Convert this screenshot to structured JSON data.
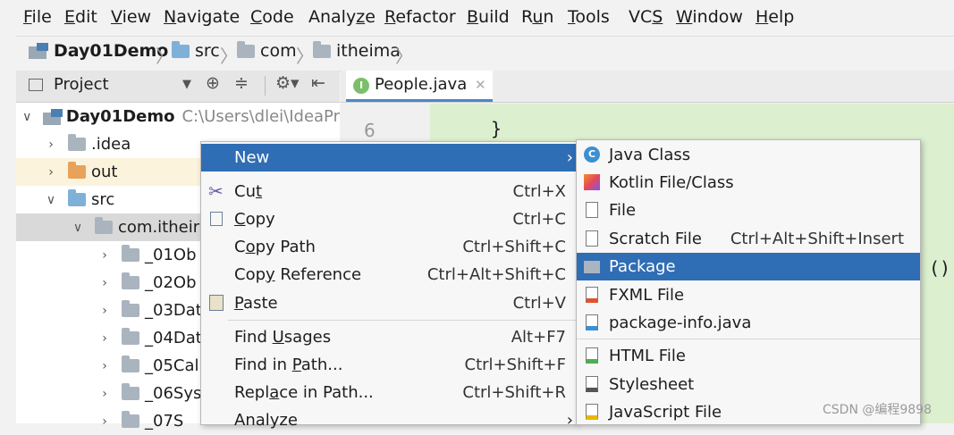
{
  "menubar": {
    "items": [
      {
        "pre": "",
        "mn": "F",
        "post": "ile"
      },
      {
        "pre": "",
        "mn": "E",
        "post": "dit"
      },
      {
        "pre": "",
        "mn": "V",
        "post": "iew"
      },
      {
        "pre": "",
        "mn": "N",
        "post": "avigate"
      },
      {
        "pre": "",
        "mn": "C",
        "post": "ode"
      },
      {
        "pre": "Analy",
        "mn": "z",
        "post": "e"
      },
      {
        "pre": "",
        "mn": "R",
        "post": "efactor"
      },
      {
        "pre": "",
        "mn": "B",
        "post": "uild"
      },
      {
        "pre": "R",
        "mn": "u",
        "post": "n"
      },
      {
        "pre": "",
        "mn": "T",
        "post": "ools"
      },
      {
        "pre": "VC",
        "mn": "S",
        "post": ""
      },
      {
        "pre": "",
        "mn": "W",
        "post": "indow"
      },
      {
        "pre": "",
        "mn": "H",
        "post": "elp"
      }
    ]
  },
  "breadcrumb": [
    "Day01Demo",
    "src",
    "com",
    "itheima"
  ],
  "project_toolbar": {
    "label": "Project",
    "icons": [
      "dropdown-icon",
      "target-icon",
      "collapse-icon",
      "gear-icon",
      "hide-icon"
    ]
  },
  "editor": {
    "tab_label": "People.java",
    "tab_badge": "I",
    "line_number": "6",
    "code": "}",
    "right_text": "()"
  },
  "tree": {
    "root": {
      "label": "Day01Demo",
      "path": "C:\\Users\\dlei\\IdeaPr"
    },
    "items": [
      ".idea",
      "out",
      "src",
      "com.itheir",
      "_01Ob",
      "_02Ob",
      "_03Dat",
      "_04Dat",
      "_05Cal",
      "_06Sys",
      "_07S"
    ]
  },
  "context_menu": {
    "new": "New",
    "cut": {
      "pre": "Cu",
      "mn": "t",
      "post": "",
      "shortcut": "Ctrl+X"
    },
    "copy": {
      "pre": "",
      "mn": "C",
      "post": "opy",
      "shortcut": "Ctrl+C"
    },
    "copy_path": {
      "pre": "C",
      "mn": "o",
      "post": "py Path",
      "shortcut": "Ctrl+Shift+C"
    },
    "copy_ref": {
      "pre": "Cop",
      "mn": "y",
      "post": " Reference",
      "shortcut": "Ctrl+Alt+Shift+C"
    },
    "paste": {
      "pre": "",
      "mn": "P",
      "post": "aste",
      "shortcut": "Ctrl+V"
    },
    "find_usages": {
      "pre": "Find ",
      "mn": "U",
      "post": "sages",
      "shortcut": "Alt+F7"
    },
    "find_in_path": {
      "pre": "Find in ",
      "mn": "P",
      "post": "ath...",
      "shortcut": "Ctrl+Shift+F"
    },
    "replace_in_path": {
      "pre": "Repl",
      "mn": "a",
      "post": "ce in Path...",
      "shortcut": "Ctrl+Shift+R"
    },
    "analyze": "Analyze"
  },
  "submenu": {
    "items": [
      {
        "label": "Java Class",
        "shortcut": ""
      },
      {
        "label": "Kotlin File/Class",
        "shortcut": ""
      },
      {
        "label": "File",
        "shortcut": ""
      },
      {
        "label": "Scratch File",
        "shortcut": "Ctrl+Alt+Shift+Insert"
      },
      {
        "label": "Package",
        "shortcut": ""
      },
      {
        "label": "FXML File",
        "shortcut": ""
      },
      {
        "label": "package-info.java",
        "shortcut": ""
      },
      {
        "label": "HTML File",
        "shortcut": ""
      },
      {
        "label": "Stylesheet",
        "shortcut": ""
      },
      {
        "label": "JavaScript File",
        "shortcut": ""
      }
    ]
  },
  "watermark": "CSDN @编程9898",
  "colors": {
    "highlight": "#2f6db5",
    "editor_green": "#dcf0d0",
    "tab_underline": "#4a88c7"
  }
}
